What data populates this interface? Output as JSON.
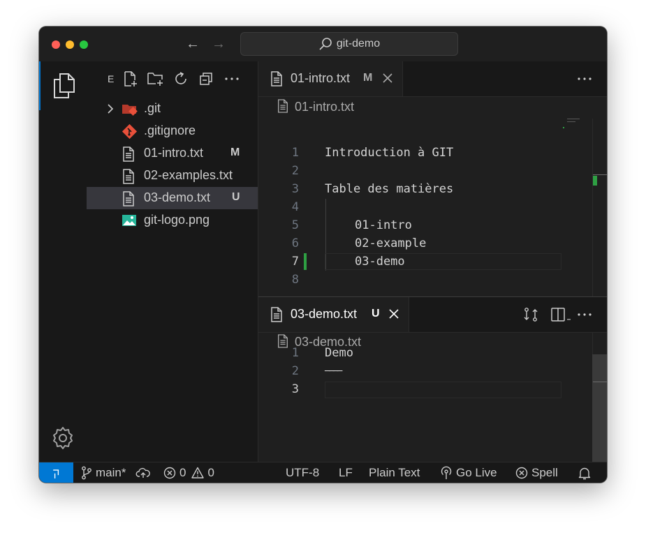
{
  "window": {
    "title": "git-demo",
    "nav_back": "←",
    "nav_forward": "→"
  },
  "explorer": {
    "title": "E",
    "items": [
      {
        "name": ".git",
        "icon": "git-folder-icon",
        "badge": ""
      },
      {
        "name": ".gitignore",
        "icon": "git-file-icon",
        "badge": ""
      },
      {
        "name": "01-intro.txt",
        "icon": "text-file-icon",
        "badge": "M"
      },
      {
        "name": "02-examples.txt",
        "icon": "text-file-icon",
        "badge": ""
      },
      {
        "name": "03-demo.txt",
        "icon": "text-file-icon",
        "badge": "U"
      },
      {
        "name": "git-logo.png",
        "icon": "image-file-icon",
        "badge": ""
      }
    ]
  },
  "editor_top": {
    "tab_label": "01-intro.txt",
    "tab_status": "M",
    "breadcrumb": "01-intro.txt",
    "lines": [
      {
        "n": "1",
        "text": "Introduction à GIT"
      },
      {
        "n": "2",
        "text": ""
      },
      {
        "n": "3",
        "text": "Table des matières"
      },
      {
        "n": "4",
        "text": ""
      },
      {
        "n": "5",
        "text": "01-intro"
      },
      {
        "n": "6",
        "text": "02-example"
      },
      {
        "n": "7",
        "text": "03-demo"
      },
      {
        "n": "8",
        "text": ""
      }
    ]
  },
  "editor_bottom": {
    "tab_label": "03-demo.txt",
    "tab_status": "U",
    "breadcrumb": "03-demo.txt",
    "lines": [
      {
        "n": "1",
        "text": "Demo"
      },
      {
        "n": "2",
        "text": "────"
      },
      {
        "n": "3",
        "text": ""
      }
    ]
  },
  "statusbar": {
    "branch": "main*",
    "errors": "0",
    "warnings": "0",
    "encoding": "UTF-8",
    "eol": "LF",
    "language": "Plain Text",
    "go_live": "Go Live",
    "spell": "Spell"
  },
  "colors": {
    "accent": "#0078d4",
    "modified_gutter": "#2ea043",
    "background": "#1f1f1f"
  }
}
